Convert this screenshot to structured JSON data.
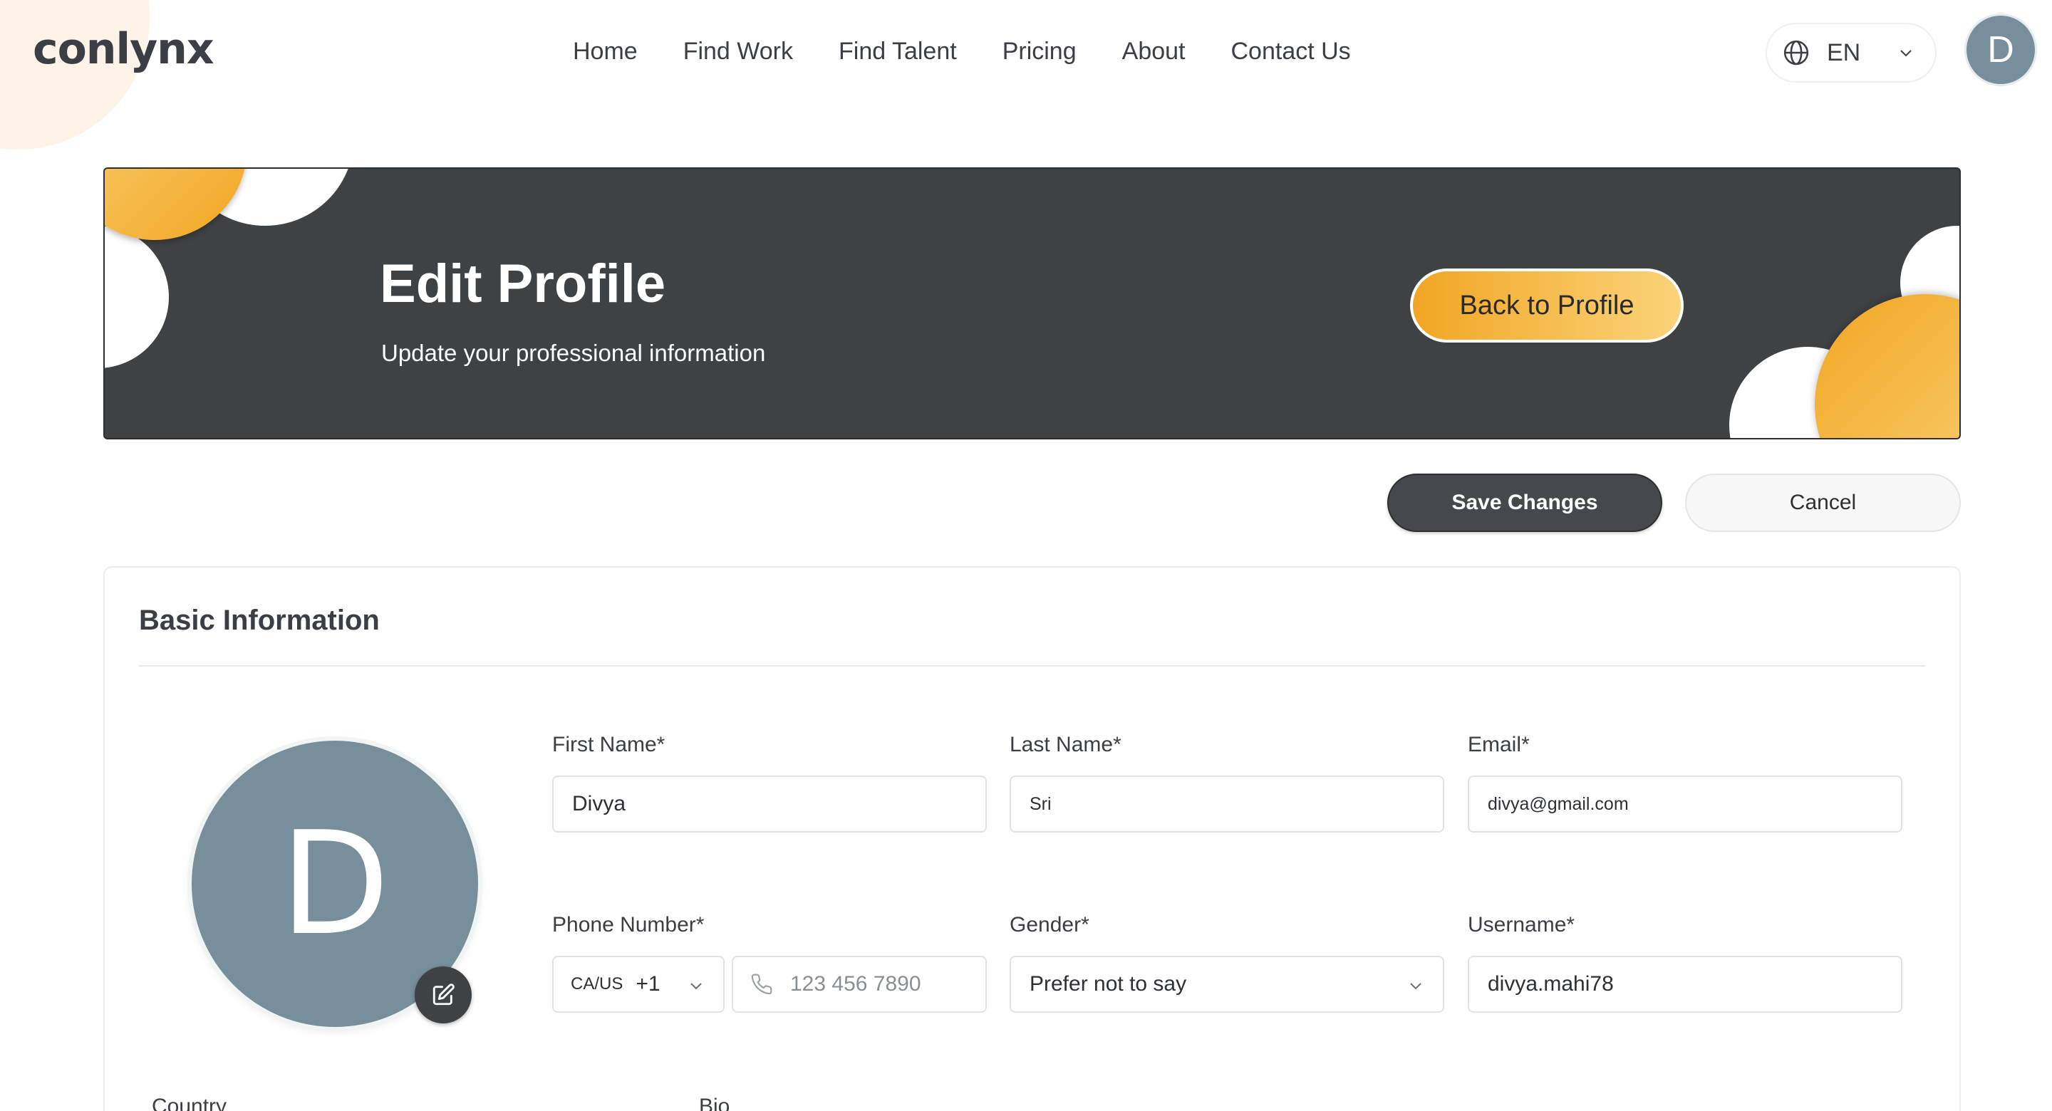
{
  "brand": {
    "logo_text": "conlynx",
    "accent": "#f1a623",
    "dark": "#3f4245",
    "avatar_bg": "#778f9a"
  },
  "nav": {
    "items": [
      {
        "label": "Home"
      },
      {
        "label": "Find Work"
      },
      {
        "label": "Find Talent"
      },
      {
        "label": "Pricing"
      },
      {
        "label": "About"
      },
      {
        "label": "Contact Us"
      }
    ]
  },
  "language": {
    "code": "EN",
    "icon": "globe-icon"
  },
  "user": {
    "initial": "D"
  },
  "banner": {
    "title": "Edit Profile",
    "subtitle": "Update your professional information",
    "back_label": "Back to Profile"
  },
  "actions": {
    "save_label": "Save Changes",
    "cancel_label": "Cancel"
  },
  "basic_info": {
    "title": "Basic Information",
    "avatar_initial": "D",
    "first_name": {
      "label": "First Name*",
      "value": "Divya"
    },
    "last_name": {
      "label": "Last Name*",
      "value": "Sri"
    },
    "email": {
      "label": "Email*",
      "value": "divya@gmail.com"
    },
    "phone": {
      "label": "Phone Number*",
      "country_code": "CA/US",
      "dial": "+1",
      "placeholder": "123 456 7890"
    },
    "gender": {
      "label": "Gender*",
      "value": "Prefer not to say"
    },
    "username": {
      "label": "Username*",
      "value": "divya.mahi78"
    },
    "country": {
      "label": "Country"
    },
    "bio": {
      "label": "Bio"
    }
  }
}
